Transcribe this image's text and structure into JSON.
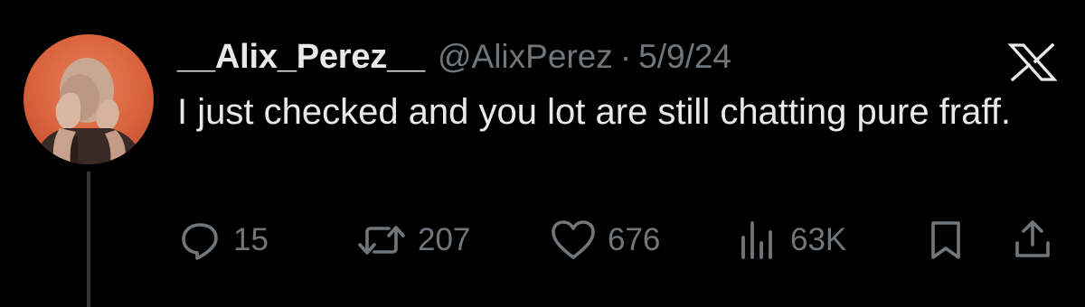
{
  "tweet": {
    "display_name": "__Alix_Perez__",
    "handle": "@AlixPerez",
    "separator": "·",
    "date": "5/9/24",
    "text": "I just checked and you lot are still chatting pure fraff.",
    "platform_icon": "x-logo-icon",
    "avatar_icon": "avatar"
  },
  "actions": {
    "reply": {
      "icon": "reply-icon",
      "count": "15"
    },
    "retweet": {
      "icon": "retweet-icon",
      "count": "207"
    },
    "like": {
      "icon": "heart-icon",
      "count": "676"
    },
    "views": {
      "icon": "views-icon",
      "count": "63K"
    },
    "bookmark": {
      "icon": "bookmark-icon"
    },
    "share": {
      "icon": "share-icon"
    }
  },
  "colors": {
    "background": "#000000",
    "primary_text": "#e7e9ea",
    "secondary_text": "#71767b",
    "thread_line": "#333639"
  }
}
